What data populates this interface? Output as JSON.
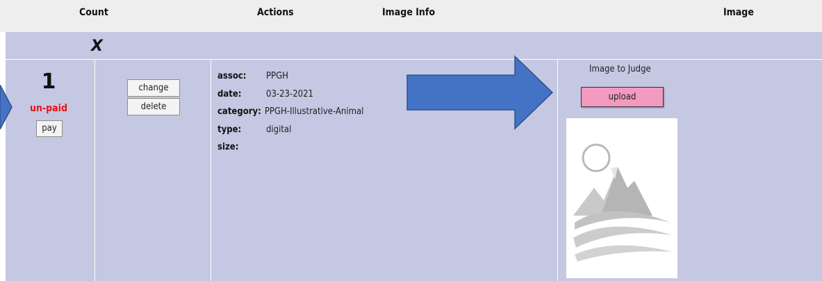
{
  "header": {
    "count": "Count",
    "actions": "Actions",
    "image_info": "Image Info",
    "image": "Image"
  },
  "group_marker": "X",
  "entry": {
    "count": "1",
    "payment_status": "un-paid",
    "pay_label": "pay",
    "change_label": "change",
    "delete_label": "delete",
    "info": {
      "assoc_key": "assoc:",
      "assoc_val": "PPGH",
      "date_key": "date:",
      "date_val": "03-23-2021",
      "category_key": "category:",
      "category_val": "PPGH-Illustrative-Animal",
      "type_key": "type:",
      "type_val": "digital",
      "size_key": "size:",
      "size_val": ""
    },
    "image_title": "Image to Judge",
    "upload_label": "upload",
    "placeholder_icon": "mountain-sun-placeholder"
  },
  "colors": {
    "row_bg": "#c5c8e2",
    "header_bg": "#eeeeee",
    "arrow_fill": "#4472c4",
    "unpaid_text": "#ee1111",
    "upload_bg": "#f29ac0"
  }
}
